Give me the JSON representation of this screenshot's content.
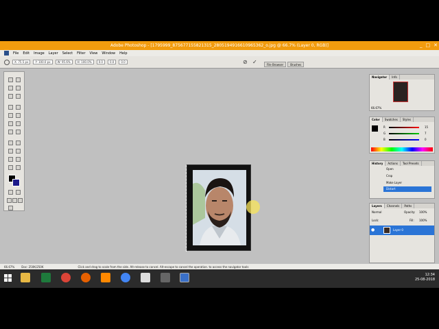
{
  "window": {
    "title": "Adobe Photoshop - [1795999_875677155821315_2805194916610965362_o.jpg @ 66.7% (Layer 0, RGB)]",
    "controls": [
      "_",
      "□",
      "✕"
    ]
  },
  "menu": [
    "File",
    "Edit",
    "Image",
    "Layer",
    "Select",
    "Filter",
    "View",
    "Window",
    "Help"
  ],
  "options": {
    "x": "X: 75.5 px",
    "y": "Y: 100.0 px",
    "w": "W: 95.6%",
    "h": "H: 100.0%",
    "angle": "0.0",
    "hskew": "0.0",
    "vskew": "0.0"
  },
  "well_tabs": [
    "File Browser",
    "Brushes"
  ],
  "navigator": {
    "tabs": [
      "Navigator",
      "Info"
    ],
    "zoom": "66.67%"
  },
  "color_panel": {
    "tabs": [
      "Color",
      "Swatches",
      "Styles"
    ],
    "r": "R",
    "g": "G",
    "b": "B",
    "r_val": "15",
    "g_val": "7",
    "b_val": "0"
  },
  "history": {
    "tabs": [
      "History",
      "Actions",
      "Tool Presets"
    ],
    "items": [
      "Open",
      "Crop",
      "Make Layer",
      "Distort"
    ]
  },
  "layers": {
    "tabs": [
      "Layers",
      "Channels",
      "Paths"
    ],
    "blend": "Normal",
    "opacity_label": "Opacity:",
    "opacity": "100%",
    "fill_label": "Fill:",
    "fill": "100%",
    "lock_label": "Lock:",
    "layer_name": "Layer 0"
  },
  "status": {
    "zoom": "66.67%",
    "doc": "Doc: 250K/250K",
    "hint": "Click and drag to scale from the side. Alt-release to cancel. Alt-escape to cancel the operation. to access the navigator tools"
  },
  "clock": {
    "time": "12:34",
    "date": "25-08-2018"
  }
}
